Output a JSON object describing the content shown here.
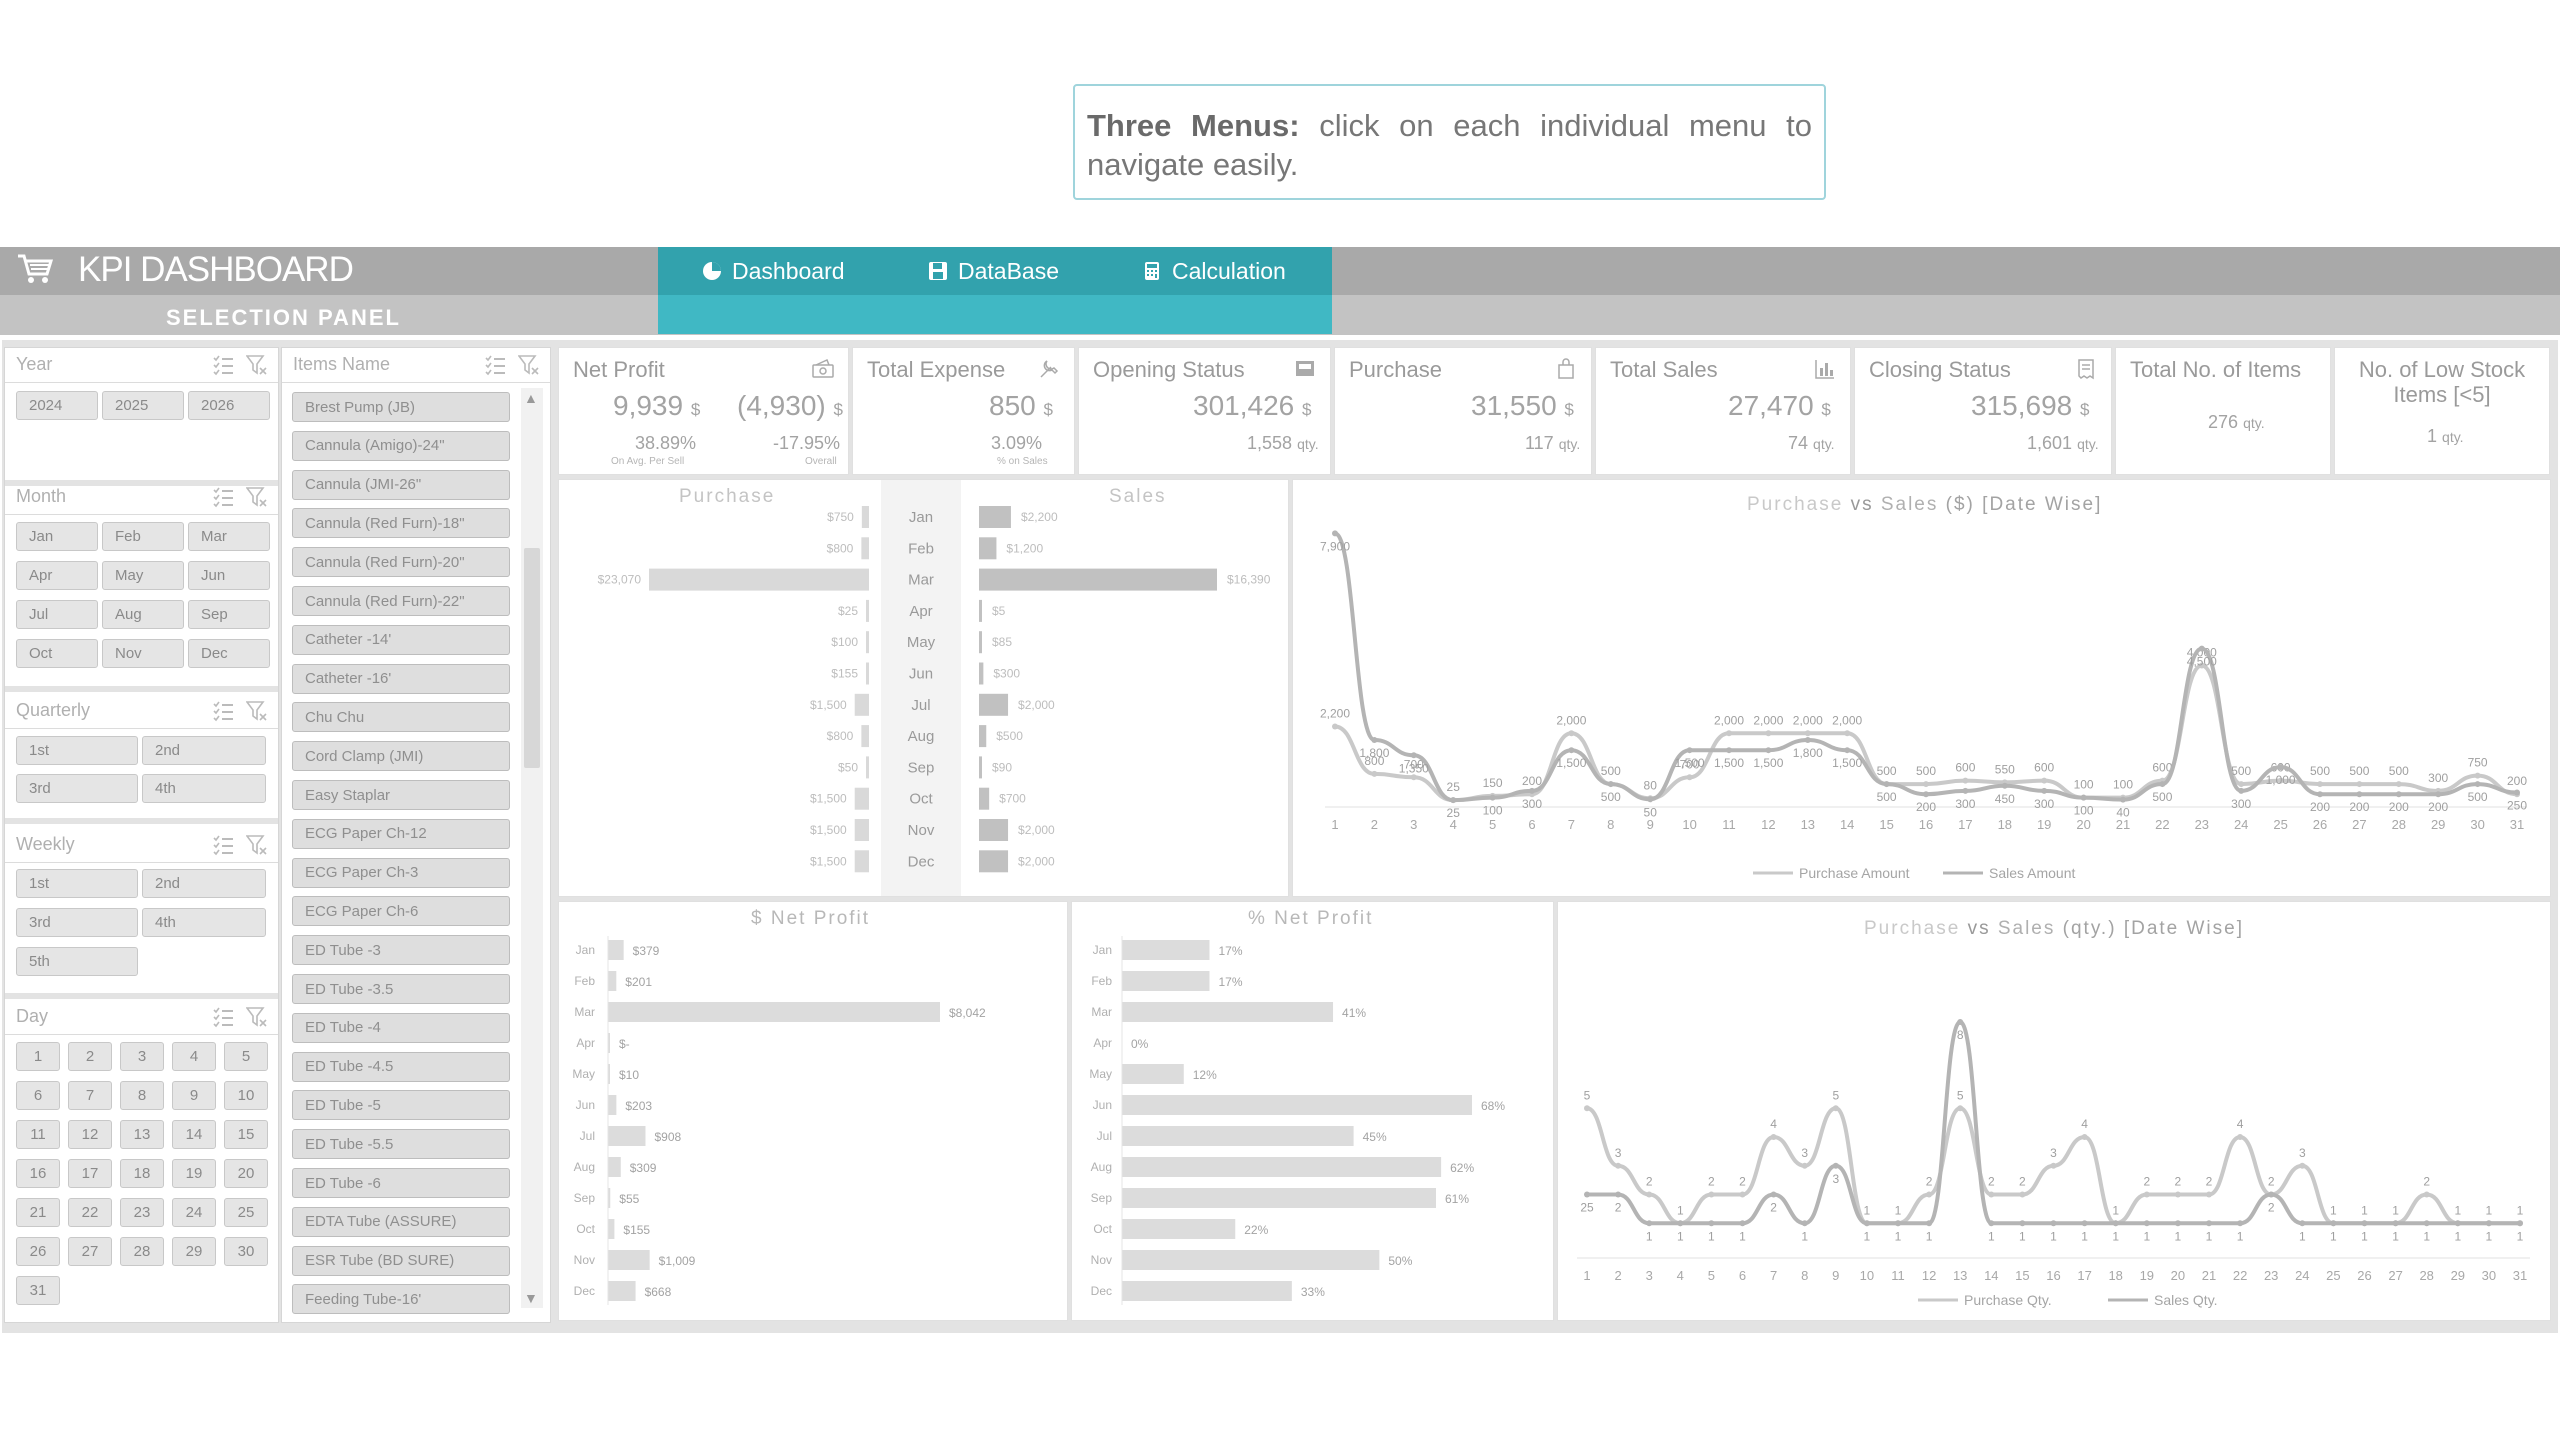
{
  "callout": {
    "bold": "Three Menus:",
    "text": " click on each individual menu to navigate easily."
  },
  "header": {
    "title": "KPI DASHBOARD",
    "selection_panel": "SELECTION PANEL"
  },
  "menu": [
    {
      "label": "Dashboard",
      "icon": "pie-chart-icon"
    },
    {
      "label": "DataBase",
      "icon": "save-icon"
    },
    {
      "label": "Calculation",
      "icon": "calculator-icon"
    }
  ],
  "filters": {
    "year": {
      "label": "Year",
      "options": [
        "2024",
        "2025",
        "2026"
      ]
    },
    "month": {
      "label": "Month",
      "options": [
        "Jan",
        "Feb",
        "Mar",
        "Apr",
        "May",
        "Jun",
        "Jul",
        "Aug",
        "Sep",
        "Oct",
        "Nov",
        "Dec"
      ]
    },
    "quarterly": {
      "label": "Quarterly",
      "options": [
        "1st",
        "2nd",
        "3rd",
        "4th"
      ]
    },
    "weekly": {
      "label": "Weekly",
      "options": [
        "1st",
        "2nd",
        "3rd",
        "4th",
        "5th"
      ]
    },
    "day": {
      "label": "Day",
      "options": [
        "1",
        "2",
        "3",
        "4",
        "5",
        "6",
        "7",
        "8",
        "9",
        "10",
        "11",
        "12",
        "13",
        "14",
        "15",
        "16",
        "17",
        "18",
        "19",
        "20",
        "21",
        "22",
        "23",
        "24",
        "25",
        "26",
        "27",
        "28",
        "29",
        "30",
        "31"
      ]
    },
    "items": {
      "label": "Items Name",
      "options": [
        "Brest Pump (JB)",
        "Cannula (Amigo)-24\"",
        "Cannula (JMI-26\"",
        "Cannula (Red Furn)-18\"",
        "Cannula (Red Furn)-20\"",
        "Cannula (Red Furn)-22\"",
        "Catheter -14'",
        "Catheter -16'",
        "Chu Chu",
        "Cord Clamp (JMI)",
        "Easy Staplar",
        "ECG Paper Ch-12",
        "ECG Paper Ch-3",
        "ECG Paper Ch-6",
        "ED Tube -3",
        "ED Tube -3.5",
        "ED Tube -4",
        "ED Tube -4.5",
        "ED Tube -5",
        "ED Tube -5.5",
        "ED Tube -6",
        "EDTA Tube (ASSURE)",
        "ESR Tube (BD SURE)",
        "Feeding Tube-16'"
      ]
    }
  },
  "kpis": {
    "net_profit": {
      "title": "Net Profit",
      "value": "9,939",
      "unit": "$",
      "value2": "(4,930)",
      "unit2": "$",
      "pct": "38.89%",
      "pct_label": "On Avg. Per Sell",
      "pct2": "-17.95%",
      "pct2_label": "Overall"
    },
    "total_expense": {
      "title": "Total Expense",
      "value": "850",
      "unit": "$",
      "pct": "3.09%",
      "pct_label": "% on Sales"
    },
    "opening_status": {
      "title": "Opening Status",
      "value": "301,426",
      "unit": "$",
      "qty": "1,558",
      "qty_unit": "qty."
    },
    "purchase": {
      "title": "Purchase",
      "value": "31,550",
      "unit": "$",
      "qty": "117",
      "qty_unit": "qty."
    },
    "total_sales": {
      "title": "Total Sales",
      "value": "27,470",
      "unit": "$",
      "qty": "74",
      "qty_unit": "qty."
    },
    "closing_status": {
      "title": "Closing Status",
      "value": "315,698",
      "unit": "$",
      "qty": "1,601",
      "qty_unit": "qty."
    },
    "total_items": {
      "title": "Total No. of Items",
      "qty": "276",
      "qty_unit": "qty."
    },
    "low_stock": {
      "title": "No. of Low Stock Items [<5]",
      "qty": "1",
      "qty_unit": "qty."
    }
  },
  "chart_data": [
    {
      "type": "bar",
      "title": "Purchase / Sales",
      "left_title": "Purchase",
      "right_title": "Sales",
      "categories": [
        "Jan",
        "Feb",
        "Mar",
        "Apr",
        "May",
        "Jun",
        "Jul",
        "Aug",
        "Sep",
        "Oct",
        "Nov",
        "Dec"
      ],
      "series": [
        {
          "name": "Purchase",
          "values": [
            750,
            800,
            23070,
            25,
            100,
            155,
            1500,
            800,
            50,
            1500,
            1500,
            1500
          ],
          "labels": [
            "$750",
            "$800",
            "$23,070",
            "$25",
            "$100",
            "$155",
            "$1,500",
            "$800",
            "$50",
            "$1,500",
            "$1,500",
            "$1,500"
          ]
        },
        {
          "name": "Sales",
          "values": [
            2200,
            1200,
            16390,
            5,
            85,
            300,
            2000,
            500,
            90,
            700,
            2000,
            2000
          ],
          "labels": [
            "$2,200",
            "$1,200",
            "$16,390",
            "$5",
            "$85",
            "$300",
            "$2,000",
            "$500",
            "$90",
            "$700",
            "$2,000",
            "$2,000"
          ]
        }
      ]
    },
    {
      "type": "line",
      "title_parts": [
        "Purchase",
        "vs",
        "Sales",
        "($)",
        "[Date Wise]"
      ],
      "x": [
        1,
        2,
        3,
        4,
        5,
        6,
        7,
        8,
        9,
        10,
        11,
        12,
        13,
        14,
        15,
        16,
        17,
        18,
        19,
        20,
        21,
        22,
        23,
        24,
        25,
        26,
        27,
        28,
        29,
        30,
        31
      ],
      "series": [
        {
          "name": "Purchase Amount",
          "values": [
            2200,
            800,
            700,
            25,
            150,
            200,
            2000,
            500,
            80,
            700,
            2000,
            2000,
            2000,
            2000,
            500,
            500,
            600,
            550,
            600,
            100,
            100,
            600,
            4000,
            500,
            600,
            500,
            500,
            500,
            300,
            750,
            200
          ],
          "labels": [
            "2,200",
            "800",
            "700",
            "25",
            "150",
            "200",
            "2,000",
            "500",
            "80",
            "700",
            "2,000",
            "2,000",
            "2,000",
            "2,000",
            "500",
            "500",
            "600",
            "550",
            "600",
            "100",
            "100",
            "600",
            "4,000",
            "500",
            "600",
            "500",
            "500",
            "500",
            "300",
            "750",
            "200"
          ]
        },
        {
          "name": "Sales Amount",
          "values": [
            7900,
            1800,
            1350,
            25,
            100,
            300,
            1500,
            500,
            50,
            1500,
            1500,
            1500,
            1800,
            1500,
            500,
            200,
            300,
            450,
            300,
            100,
            40,
            500,
            4500,
            300,
            1000,
            200,
            200,
            200,
            200,
            500,
            250
          ],
          "labels": [
            "7,900",
            "1,800",
            "1,350",
            "25",
            "100",
            "300",
            "1,500",
            "500",
            "50",
            "1,500",
            "1,500",
            "1,500",
            "1,800",
            "1,500",
            "500",
            "200",
            "300",
            "450",
            "300",
            "100",
            "40",
            "500",
            "4,500",
            "300",
            "1,000",
            "200",
            "200",
            "200",
            "200",
            "500",
            "250"
          ]
        }
      ]
    },
    {
      "type": "bar",
      "title": "$ Net Profit",
      "categories": [
        "Jan",
        "Feb",
        "Mar",
        "Apr",
        "May",
        "Jun",
        "Jul",
        "Aug",
        "Sep",
        "Oct",
        "Nov",
        "Dec"
      ],
      "values": [
        379,
        201,
        8042,
        0,
        10,
        203,
        908,
        309,
        55,
        155,
        1009,
        668
      ],
      "labels": [
        "$379",
        "$201",
        "$8,042",
        "$-",
        "$10",
        "$203",
        "$908",
        "$309",
        "$55",
        "$155",
        "$1,009",
        "$668"
      ]
    },
    {
      "type": "bar",
      "title": "% Net Profit",
      "categories": [
        "Jan",
        "Feb",
        "Mar",
        "Apr",
        "May",
        "Jun",
        "Jul",
        "Aug",
        "Sep",
        "Oct",
        "Nov",
        "Dec"
      ],
      "values": [
        17,
        17,
        41,
        0,
        12,
        68,
        45,
        62,
        61,
        22,
        50,
        33
      ],
      "labels": [
        "17%",
        "17%",
        "41%",
        "0%",
        "12%",
        "68%",
        "45%",
        "62%",
        "61%",
        "22%",
        "50%",
        "33%"
      ]
    },
    {
      "type": "line",
      "title_parts": [
        "Purchase",
        "vs",
        "Sales",
        "(qty.)",
        "[Date Wise]"
      ],
      "x": [
        1,
        2,
        3,
        4,
        5,
        6,
        7,
        8,
        9,
        10,
        11,
        12,
        13,
        14,
        15,
        16,
        17,
        18,
        19,
        20,
        21,
        22,
        23,
        24,
        25,
        26,
        27,
        28,
        29,
        30,
        31
      ],
      "series": [
        {
          "name": "Purchase Qty.",
          "values": [
            5,
            3,
            2,
            1,
            2,
            2,
            4,
            3,
            5,
            1,
            1,
            2,
            5,
            2,
            2,
            3,
            4,
            1,
            2,
            2,
            2,
            4,
            2,
            3,
            1,
            1,
            1,
            2,
            1,
            1,
            1
          ],
          "labels": [
            "5",
            "3",
            "2",
            "1",
            "2",
            "2",
            "4",
            "3",
            "5",
            "1",
            "1",
            "2",
            "5",
            "2",
            "2",
            "3",
            "4",
            "1",
            "2",
            "2",
            "2",
            "4",
            "2",
            "3",
            "1",
            "1",
            "1",
            "2",
            "1",
            "1",
            "1"
          ]
        },
        {
          "name": "Sales Qty.",
          "values": [
            2,
            2,
            1,
            1,
            1,
            1,
            2,
            1,
            3,
            1,
            1,
            1,
            8,
            1,
            1,
            1,
            1,
            1,
            1,
            1,
            1,
            1,
            2,
            1,
            1,
            1,
            1,
            1,
            1,
            1,
            1
          ],
          "labels": [
            "25",
            "2",
            "1",
            "1",
            "1",
            "1",
            "2",
            "1",
            "3",
            "1",
            "1",
            "1",
            "8",
            "1",
            "1",
            "1",
            "1",
            "1",
            "1",
            "1",
            "1",
            "1",
            "2",
            "1",
            "1",
            "1",
            "1",
            "1",
            "1",
            "1",
            "1"
          ]
        }
      ]
    }
  ]
}
